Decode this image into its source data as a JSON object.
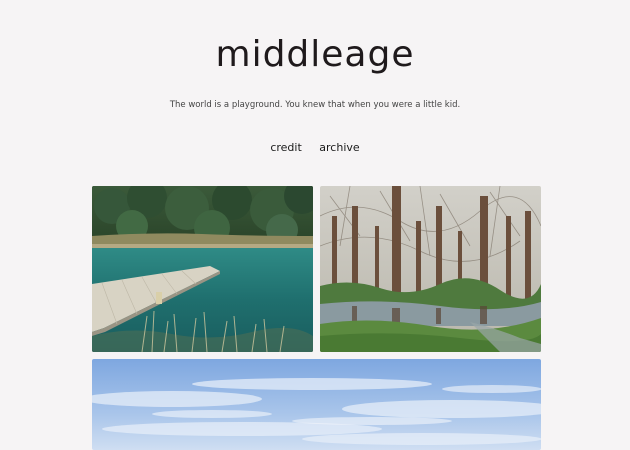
{
  "site": {
    "title": "middleage",
    "tagline": "The world is a playground. You knew that when you were a little kid."
  },
  "nav": {
    "items": [
      {
        "label": "credit"
      },
      {
        "label": "archive"
      }
    ]
  },
  "posts": [
    {
      "type": "photo",
      "subject": "lake-dock"
    },
    {
      "type": "photo",
      "subject": "forest-wetland"
    },
    {
      "type": "photo",
      "subject": "sky"
    }
  ]
}
